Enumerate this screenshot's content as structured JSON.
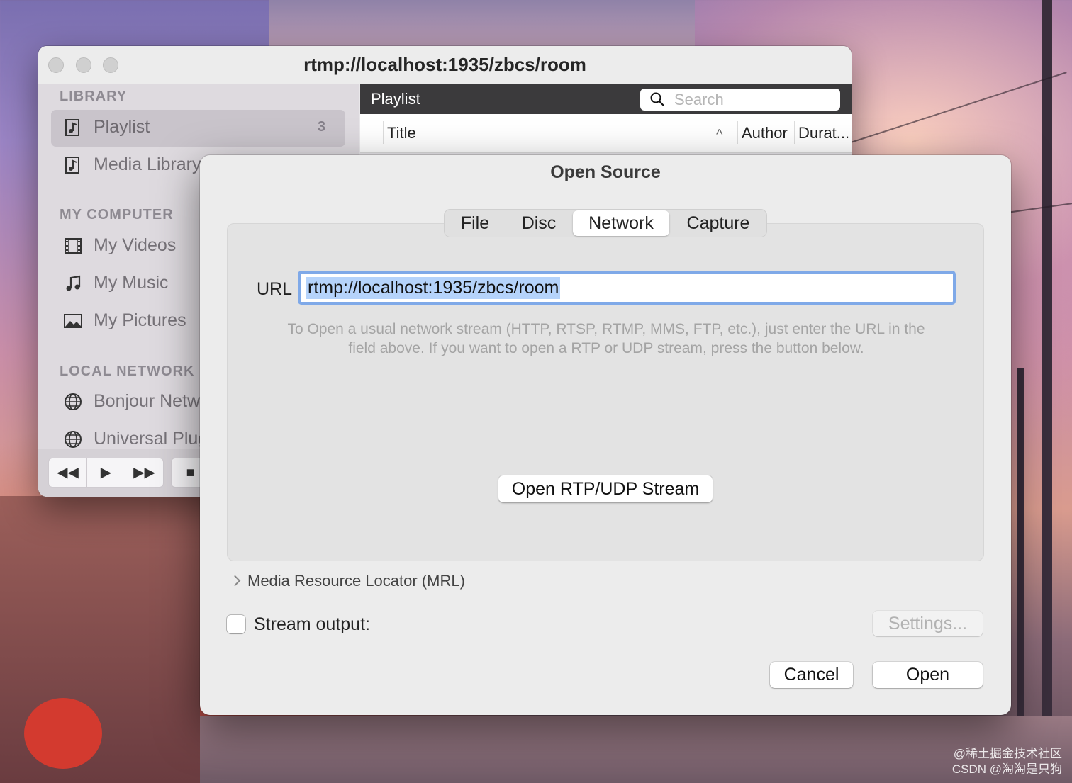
{
  "window": {
    "title": "rtmp://localhost:1935/zbcs/room"
  },
  "sidebar": {
    "sections": [
      {
        "heading": "LIBRARY",
        "items": [
          {
            "label": "Playlist",
            "icon": "playlist-icon",
            "count": "3",
            "selected": true
          },
          {
            "label": "Media Library",
            "icon": "playlist-icon"
          }
        ]
      },
      {
        "heading": "MY COMPUTER",
        "items": [
          {
            "label": "My Videos",
            "icon": "film-icon"
          },
          {
            "label": "My Music",
            "icon": "music-note-icon"
          },
          {
            "label": "My Pictures",
            "icon": "picture-icon"
          }
        ]
      },
      {
        "heading": "LOCAL NETWORK",
        "items": [
          {
            "label": "Bonjour Network Discovery",
            "icon": "network-globe-icon"
          },
          {
            "label": "Universal Plug'n'Play",
            "icon": "network-globe-icon"
          }
        ]
      }
    ]
  },
  "controls": {
    "rewind": "◀◀",
    "play": "▶",
    "fast_forward": "▶▶",
    "stop": "■"
  },
  "playlist": {
    "header": "Playlist",
    "search_placeholder": "Search",
    "columns": {
      "title": "Title",
      "author": "Author",
      "duration": "Durat..."
    },
    "sort_indicator": "^"
  },
  "dialog": {
    "title": "Open Source",
    "tabs": [
      "File",
      "Disc",
      "Network",
      "Capture"
    ],
    "active_tab": "Network",
    "url_label": "URL",
    "url_value": "rtmp://localhost:1935/zbcs/room",
    "hint_line1": "To Open a usual network stream (HTTP, RTSP, RTMP, MMS, FTP, etc.), just enter the URL in the",
    "hint_line2": "field above. If you want to open a RTP or UDP stream, press the button below.",
    "rtp_button": "Open RTP/UDP Stream",
    "mrl_disclosure": "Media Resource Locator (MRL)",
    "stream_output_label": "Stream output:",
    "stream_output_checked": false,
    "settings_button": "Settings...",
    "cancel_button": "Cancel",
    "open_button": "Open"
  },
  "watermark": {
    "line1": "@稀土掘金技术社区",
    "line2": "CSDN @淘淘是只狗"
  },
  "colors": {
    "accent_focus": "#7fa9e8",
    "selection": "#b5d3fb",
    "playlist_header_bg": "#3b3a3c"
  }
}
